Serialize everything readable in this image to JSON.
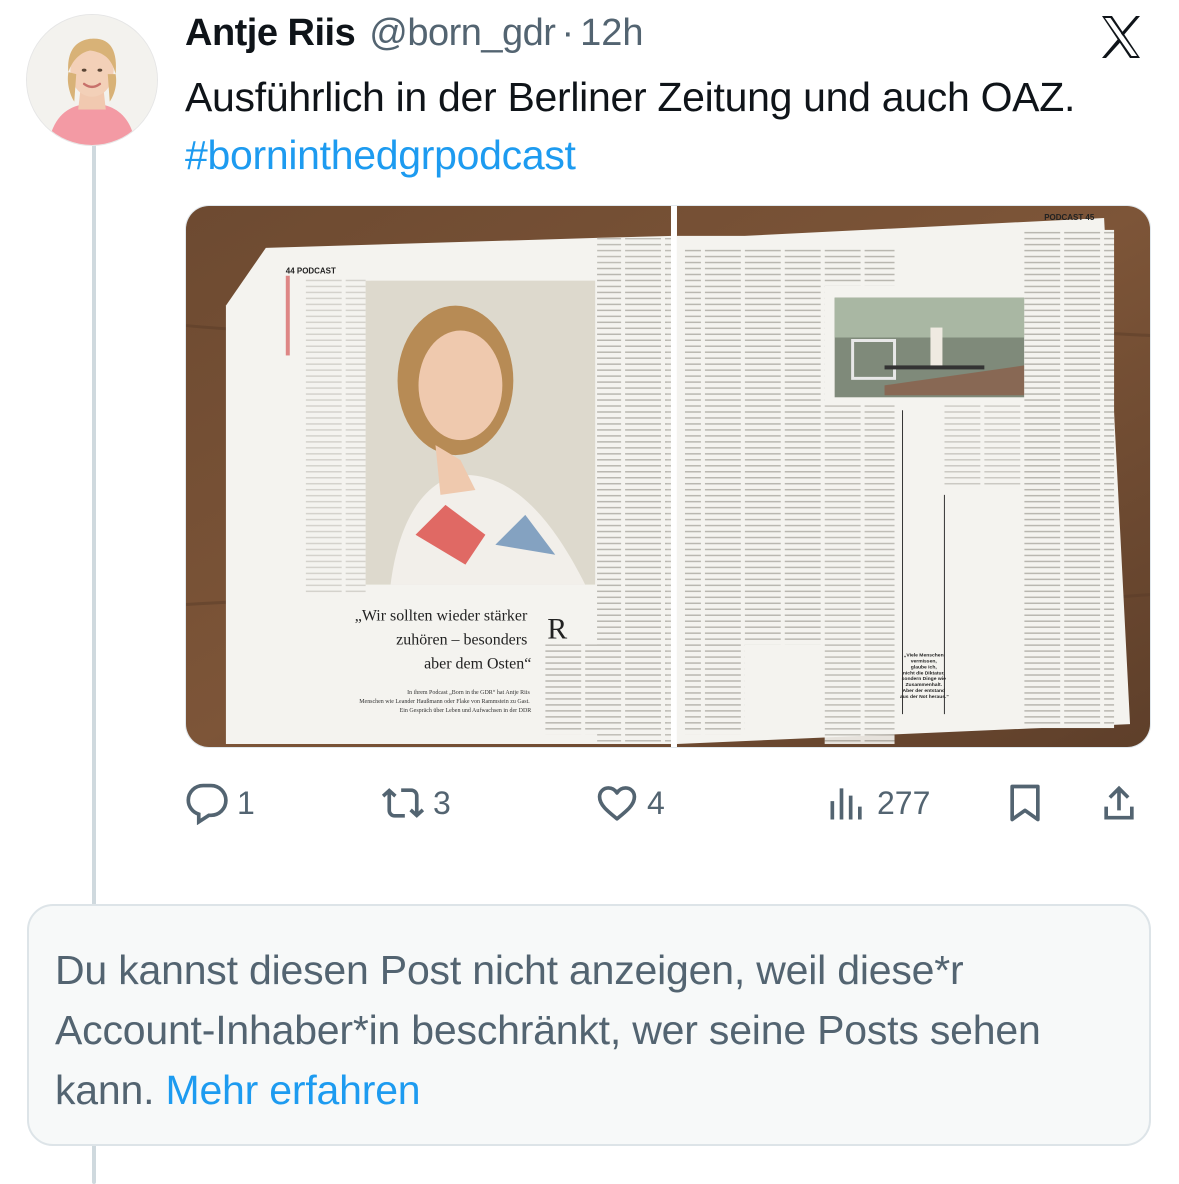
{
  "post": {
    "display_name": "Antje Riis",
    "handle": "@born_gdr",
    "separator": "·",
    "time": "12h",
    "text_main": "Ausführlich in der Berliner Zeitung und auch OAZ. ",
    "hashtag": "#borninthedgrpodcast"
  },
  "media": {
    "page_left": "44 PODCAST",
    "page_right": "PODCAST 45",
    "headline": [
      "„Wir sollten wieder stärker",
      "zuhören – besonders",
      "aber dem Osten“"
    ],
    "dropcap": "R",
    "teaser": [
      "In ihrem Podcast „Born in the GDR“ hat Antje Riis",
      "Menschen wie Leander Haußmann oder Flake von Rammstein zu Gast.",
      "Ein Gespräch über Leben und Aufwachsen in der DDR"
    ],
    "quote": [
      "„Viele Menschen",
      "vermissen,",
      "glaube ich,",
      "nicht die Diktatur,",
      "sondern Dinge wie",
      "Zusammenhalt.",
      "Aber der entstand",
      "aus der Not heraus.“"
    ]
  },
  "actions": {
    "replies": "1",
    "reposts": "3",
    "likes": "4",
    "views": "277"
  },
  "icons": {
    "x_logo": "x-logo-icon",
    "reply": "reply-icon",
    "repost": "repost-icon",
    "like": "heart-icon",
    "views": "views-icon",
    "bookmark": "bookmark-icon",
    "share": "share-icon"
  },
  "notice": {
    "text": "Du kannst diesen Post nicht anzeigen, weil diese*r Account-Inhaber*in beschränkt, wer seine Posts sehen kann. ",
    "link": "Mehr erfahren"
  },
  "colors": {
    "accent": "#1d9bf0",
    "secondary_text": "#536471",
    "thread_line": "#cfd9de",
    "notice_bg": "#f7f9f9"
  }
}
